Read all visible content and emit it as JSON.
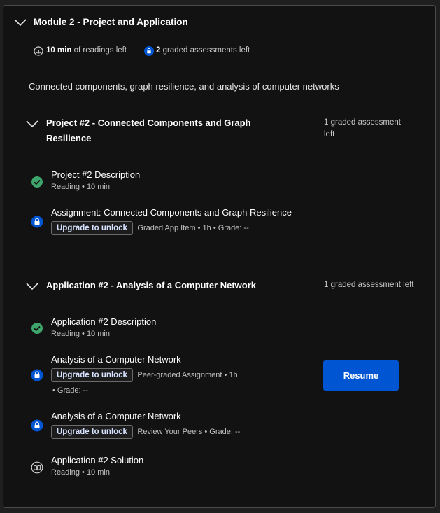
{
  "module": {
    "title": "Module 2 - Project and Application",
    "readings_value": "10 min",
    "readings_suffix": "of readings left",
    "graded_value": "2",
    "graded_suffix": "graded assessments left",
    "description": "Connected components, graph resilience, and analysis of computer networks"
  },
  "sections": [
    {
      "title_line1": "Project #2 - Connected Components and Graph",
      "title_line2": "Resilience",
      "right_line1": "1 graded assessment",
      "right_line2": "left",
      "items": [
        {
          "title": "Project #2 Description",
          "subtitle": "Reading • 10 min",
          "icon": "check-icon"
        },
        {
          "title": "Assignment: Connected Components and Graph Resilience",
          "upgrade": "Upgrade to unlock",
          "subtitle": "Graded App Item • 1h • Grade: --",
          "icon": "lock-icon"
        }
      ]
    },
    {
      "title": "Application #2 - Analysis of a Computer Network",
      "right": "1 graded assessment left",
      "items": [
        {
          "title": "Application #2 Description",
          "subtitle": "Reading • 10 min",
          "icon": "check-icon"
        },
        {
          "title": "Analysis of a Computer Network",
          "upgrade": "Upgrade to unlock",
          "subtitle": "Peer-graded Assignment • 1h",
          "subtitle2": "• Grade: --",
          "icon": "lock-icon"
        },
        {
          "title": "Analysis of a Computer Network",
          "upgrade": "Upgrade to unlock",
          "subtitle": "Review Your Peers • Grade: --",
          "icon": "lock-icon"
        },
        {
          "title": "Application #2 Solution",
          "subtitle": "Reading • 10 min",
          "icon": "book-icon"
        }
      ]
    }
  ],
  "resume_label": "Resume",
  "colors": {
    "accent": "#0056d2",
    "success": "#3fa66b",
    "background": "#121212"
  }
}
